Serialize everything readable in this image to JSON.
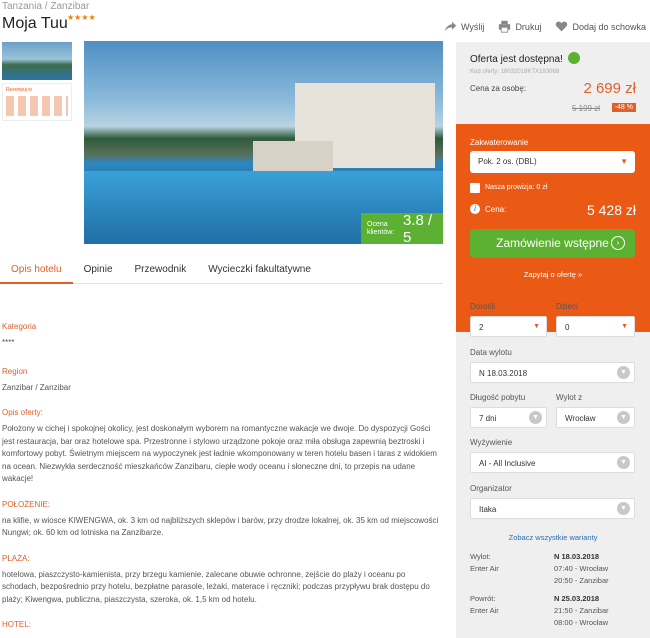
{
  "breadcrumb": "Tanzania / Zanzibar",
  "hotel": {
    "name": "Moja Tuu",
    "stars": "★★★★"
  },
  "actions": {
    "share": "Wyślij",
    "print": "Drukuj",
    "save": "Dodaj do schowka"
  },
  "thumb_text": "Rezerwuj w",
  "rating": {
    "label": "Ocena klientów:",
    "value": "3.8 / 5"
  },
  "tabs": [
    "Opis hotelu",
    "Opinie",
    "Przewodnik",
    "Wycieczki fakultatywne"
  ],
  "content": {
    "kategoria_h": "Kategoria",
    "kategoria_v": "****",
    "region_h": "Region",
    "region_v": "Zanzibar / Zanzibar",
    "opis_h": "Opis oferty:",
    "opis_v": "Położony w cichej i spokojnej okolicy, jest doskonałym wyborem na romantyczne wakacje we dwoje. Do dyspozycji Gości jest restauracja, bar oraz hotelowe spa. Przestronne i stylowo urządzone pokoje oraz miła obsługa zapewnią beztroski i komfortowy pobyt. Świetnym miejscem na wypoczynek jest ładnie wkomponowany w teren hotelu basen i taras z widokiem na ocean. Niezwykła serdeczność mieszkańców Zanzibaru, ciepłe wody oceanu i słoneczne dni, to przepis na udane wakacje!",
    "polozenie_h": "POŁOŻENIE:",
    "polozenie_v": "na klifie, w wiosce KIWENGWA, ok. 3 km od najbliższych sklepów i barów, przy drodze lokalnej, ok. 35 km od miejscowości Nungwi; ok. 60 km od lotniska na Zanzibarze.",
    "plaza_h": "PLAŻA:",
    "plaza_v": "hotelowa, piaszczysto-kamienista, przy brzegu kamienie, zalecane obuwie ochronne, zejście do plaży i oceanu po schodach, bezpośrednio przy hotelu, bezpłatne parasole, leżaki, materace i ręczniki; podczas przypływu brak dostępu do plaży; Kiwengwa, publiczna, piaszczysta, szeroka, ok. 1,5 km od hotelu.",
    "hotel_h": "HOTEL:"
  },
  "offer": {
    "title": "Oferta jest dostępna!",
    "code": "Kod oferty: 18032018KTX193068",
    "price_label": "Cena za osobę:",
    "price": "2 699 zł",
    "old_price": "5 199 zł",
    "discount": "-48 %"
  },
  "booking": {
    "room_label": "Zakwaterowanie",
    "room_value": "Pok. 2 os. (DBL)",
    "commission": "Nasza prowizja: 0 zł",
    "total_label": "Cena:",
    "total": "5 428 zł",
    "button": "Zamówienie wstępne",
    "ask": "Zapytaj o ofertę »"
  },
  "filters": {
    "adults_label": "Dorośli",
    "adults": "2",
    "children_label": "Dzieci",
    "children": "0",
    "date_label": "Data wylotu",
    "date": "N 18.03.2018",
    "length_label": "Długość pobytu",
    "length": "7 dni",
    "from_label": "Wylot z",
    "from": "Wrocław",
    "board_label": "Wyżywienie",
    "board": "AI - All Inclusive",
    "org_label": "Organizator",
    "org": "Itaka",
    "all_variants": "Zobacz wszystkie warianty"
  },
  "flights": {
    "out_label": "Wylot:",
    "out_date": "N 18.03.2018",
    "out_airline": "Enter Air",
    "out_dep": "07:40 - Wrocław",
    "out_arr": "20:50 - Zanzibar",
    "ret_label": "Powrót:",
    "ret_date": "N 25.03.2018",
    "ret_airline": "Enter Air",
    "ret_dep": "21:50 - Zanzibar",
    "ret_arr": "08:00 - Wrocław"
  }
}
